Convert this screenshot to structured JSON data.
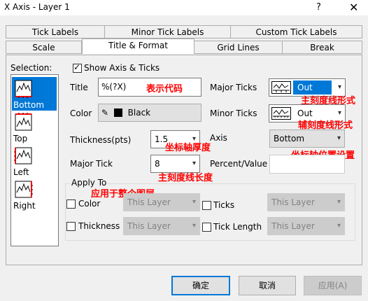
{
  "window": {
    "title": "X Axis - Layer 1",
    "help_icon": "?",
    "close_icon": "✕"
  },
  "tabs": {
    "row1": [
      "Tick Labels",
      "Minor Tick Labels",
      "Custom Tick Labels"
    ],
    "row2": [
      "Scale",
      "Title & Format",
      "Grid Lines",
      "Break"
    ]
  },
  "selection": {
    "label": "Selection:",
    "items": [
      "Bottom",
      "Top",
      "Left",
      "Right"
    ],
    "selected": "Bottom"
  },
  "show_axis": {
    "label": "Show Axis & Ticks",
    "checked": true
  },
  "form": {
    "title_label": "Title",
    "title_value": "%(?X)",
    "color_label": "Color",
    "color_value": "Black",
    "thickness_label": "Thickness(pts)",
    "thickness_value": "1.5",
    "major_tick_label": "Major Tick",
    "major_tick_value": "8",
    "major_ticks_label": "Major Ticks",
    "major_ticks_value": "Out",
    "minor_ticks_label": "Minor Ticks",
    "minor_ticks_value": "Out",
    "axis_label": "Axis",
    "axis_value": "Bottom",
    "percent_label": "Percent/Value",
    "percent_value": ""
  },
  "apply_to": {
    "label": "Apply To",
    "color_label": "Color",
    "thickness_label": "Thickness",
    "ticks_label": "Ticks",
    "tick_length_label": "Tick Length",
    "layer_option": "This Layer"
  },
  "annotations": {
    "title": "表示代码",
    "major_ticks": "主刻度线形式",
    "minor_ticks": "辅刻度线形式",
    "thickness": "坐标轴厚度",
    "axis": "坐标轴位置设置",
    "major_tick": "主刻度线长度",
    "apply_to": "应用于整个图层"
  },
  "buttons": {
    "ok": "确定",
    "cancel": "取消",
    "apply": "应用(A)"
  },
  "colors": {
    "accent": "#0078d7",
    "annotation": "#ff0000"
  }
}
